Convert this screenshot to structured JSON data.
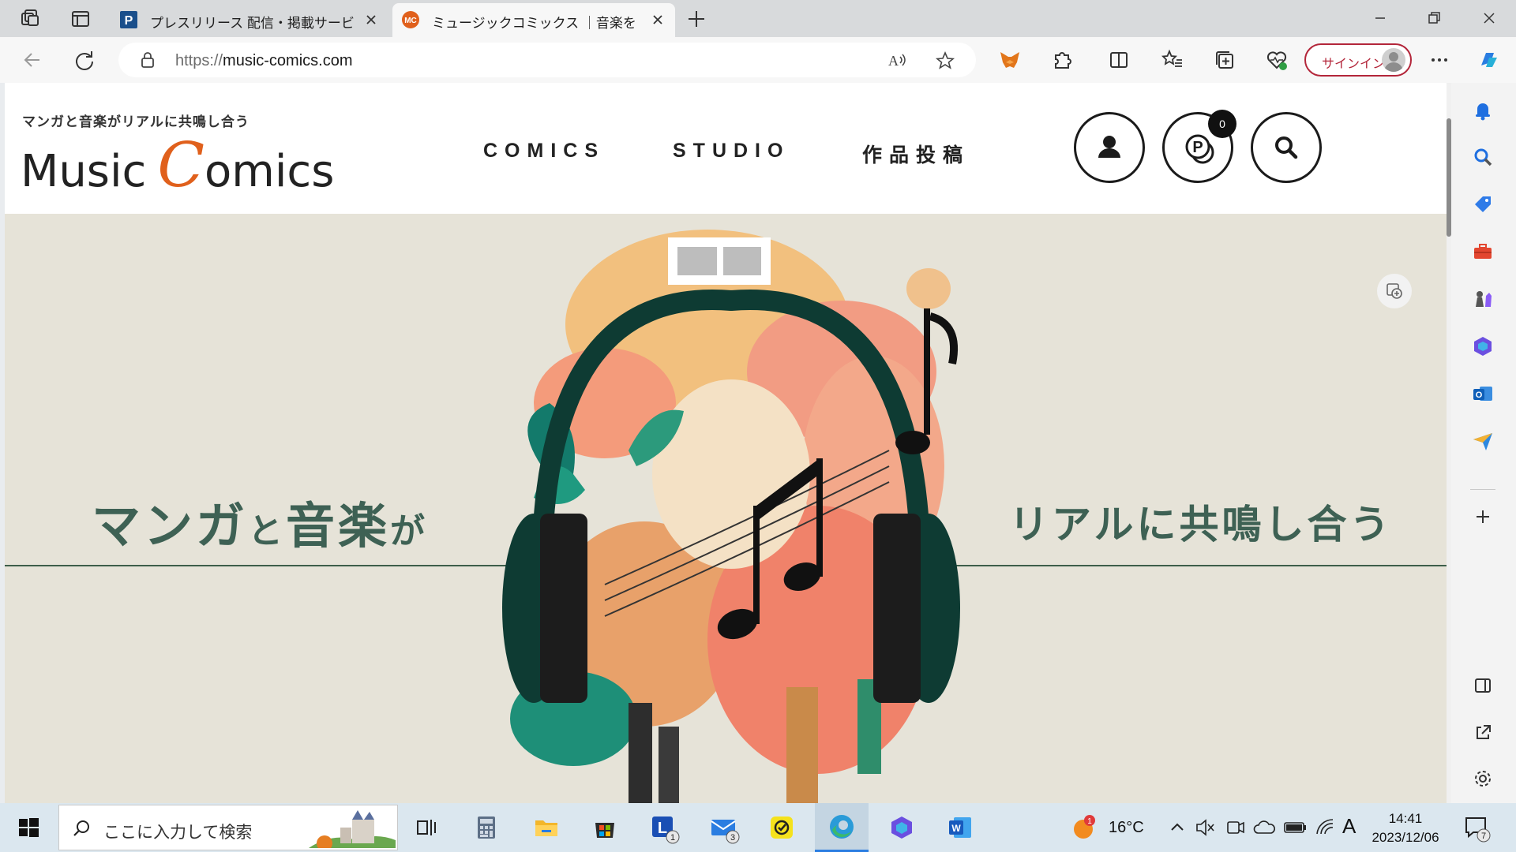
{
  "browser": {
    "tabs": [
      {
        "title": "プレスリリース 配信・掲載サービスのPR TIMES",
        "active": false
      },
      {
        "title": "ミュージックコミックス ｜音楽をテーマにしたマンガ",
        "active": true
      }
    ],
    "url_scheme": "https://",
    "url_host": "music-comics.com",
    "signin_label": "サインイン"
  },
  "site": {
    "tagline": "マンガと音楽がリアルに共鳴し合う",
    "logo": {
      "part1": "Music",
      "big_c": "C",
      "part2": "omics"
    },
    "nav": [
      "COMICS",
      "STUDIO",
      "作品投稿"
    ],
    "points_badge": "0",
    "hero": {
      "left_big1": "マンガ",
      "left_small1": "と",
      "left_big2": "音楽",
      "left_small2": "が",
      "right_text": "リアルに共鳴し合う"
    }
  },
  "taskbar": {
    "search_placeholder": "ここに入力して検索",
    "temperature": "16°C",
    "time": "14:41",
    "date": "2023/12/06",
    "ime_mode": "A",
    "weather_badge": "1",
    "lens_badge": "1",
    "mail_badge": "3",
    "notification_count": "7"
  },
  "colors": {
    "accent_orange": "#e0601c",
    "hero_bg": "#e6e3d8",
    "hero_text": "#3e6154",
    "signin_red": "#b3263a"
  }
}
